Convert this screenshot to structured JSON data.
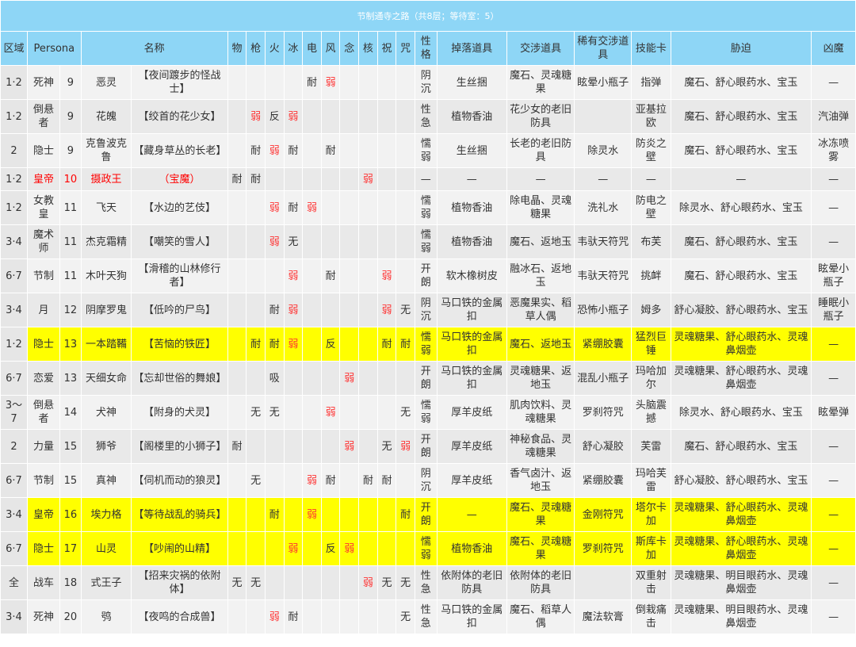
{
  "title": "节制通寺之路（共8层；等待室：5）",
  "headers": [
    "区域",
    "Persona",
    "",
    "名称",
    "物",
    "枪",
    "火",
    "冰",
    "电",
    "风",
    "念",
    "核",
    "祝",
    "咒",
    "性格",
    "掉落道具",
    "交涉道具",
    "稀有交涉道具",
    "技能卡",
    "胁迫",
    "凶魔"
  ],
  "colors": {
    "header_bg": "#8ed6f6",
    "highlight": "#ffff00",
    "weak": "#ff3333"
  },
  "rows": [
    {
      "zone": "1·2",
      "arcana": "死神",
      "lv": "9",
      "persona": "恶灵",
      "name": "【夜间踱步的怪战士】",
      "res": [
        "",
        "",
        "",
        "",
        "耐",
        "弱",
        "",
        "",
        "",
        ""
      ],
      "nature": "阴沉",
      "drop": "生丝捆",
      "nego": "魔石、灵魂糖果",
      "rare": "眩晕小瓶子",
      "card": "指弹",
      "threat": "魔石、舒心眼药水、宝玉",
      "demon": "—"
    },
    {
      "zone": "1·2",
      "arcana": "倒悬者",
      "lv": "9",
      "persona": "花魄",
      "name": "【绞首的花少女】",
      "res": [
        "",
        "弱",
        "反",
        "弱",
        "",
        "",
        "",
        "",
        "",
        ""
      ],
      "nature": "性急",
      "drop": "植物香油",
      "nego": "花少女的老旧防具",
      "rare": "",
      "card": "亚基拉欧",
      "threat": "魔石、舒心眼药水、宝玉",
      "demon": "汽油弹"
    },
    {
      "zone": "2",
      "arcana": "隐士",
      "lv": "9",
      "persona": "克鲁波克鲁",
      "name": "【藏身草丛的长老】",
      "res": [
        "",
        "耐",
        "弱",
        "耐",
        "",
        "耐",
        "",
        "",
        "",
        ""
      ],
      "nature": "懦弱",
      "drop": "生丝捆",
      "nego": "长老的老旧防具",
      "rare": "除灵水",
      "card": "防炎之壁",
      "threat": "魔石、舒心眼药水、宝玉",
      "demon": "冰冻喷雾"
    },
    {
      "zone": "1·2",
      "arcana": "皇帝",
      "lv": "10",
      "persona": "摄政王",
      "name": "（宝魔）",
      "res": [
        "耐",
        "耐",
        "",
        "",
        "",
        "",
        "",
        "弱",
        "",
        ""
      ],
      "nature": "—",
      "drop": "—",
      "nego": "—",
      "rare": "—",
      "card": "—",
      "threat": "—",
      "demon": "—"
    },
    {
      "zone": "1·2",
      "arcana": "女教皇",
      "lv": "11",
      "persona": "飞天",
      "name": "【水边的艺伎】",
      "res": [
        "",
        "",
        "弱",
        "耐",
        "弱",
        "",
        "",
        "",
        "",
        ""
      ],
      "nature": "懦弱",
      "drop": "植物香油",
      "nego": "除电晶、灵魂糖果",
      "rare": "洗礼水",
      "card": "防电之壁",
      "threat": "除灵水、舒心眼药水、宝玉",
      "demon": "—"
    },
    {
      "zone": "3·4",
      "arcana": "魔术师",
      "lv": "11",
      "persona": "杰克霜精",
      "name": "【嘲笑的雪人】",
      "res": [
        "",
        "",
        "弱",
        "无",
        "",
        "",
        "",
        "",
        "",
        ""
      ],
      "nature": "懦弱",
      "drop": "植物香油",
      "nego": "魔石、返地玉",
      "rare": "韦驮天符咒",
      "card": "布芙",
      "threat": "魔石、舒心眼药水、宝玉",
      "demon": "—"
    },
    {
      "zone": "6·7",
      "arcana": "节制",
      "lv": "11",
      "persona": "木叶天狗",
      "name": "【滑稽的山林修行者】",
      "res": [
        "",
        "",
        "",
        "弱",
        "",
        "耐",
        "",
        "",
        "弱",
        ""
      ],
      "nature": "开朗",
      "drop": "软木橡树皮",
      "nego": "融冰石、返地玉",
      "rare": "韦驮天符咒",
      "card": "挑衅",
      "threat": "魔石、舒心眼药水、宝玉",
      "demon": "眩晕小瓶子"
    },
    {
      "zone": "3·4",
      "arcana": "月",
      "lv": "12",
      "persona": "阴摩罗鬼",
      "name": "【低吟的尸鸟】",
      "res": [
        "",
        "",
        "耐",
        "弱",
        "",
        "",
        "",
        "",
        "弱",
        "无"
      ],
      "nature": "阴沉",
      "drop": "马口铁的金属扣",
      "nego": "恶魔果实、稻草人偶",
      "rare": "恐怖小瓶子",
      "card": "姆多",
      "threat": "舒心凝胶、舒心眼药水、宝玉",
      "demon": "睡眠小瓶子"
    },
    {
      "zone": "1·2",
      "arcana": "隐士",
      "lv": "13",
      "persona": "一本踏鞴",
      "name": "【苦恼的铁匠】",
      "res": [
        "",
        "耐",
        "耐",
        "弱",
        "",
        "反",
        "",
        "",
        "耐",
        "耐"
      ],
      "nature": "懦弱",
      "drop": "马口铁的金属扣",
      "nego": "魔石、返地玉",
      "rare": "紧绷胶囊",
      "card": "猛烈巨锤",
      "threat": "灵魂糖果、舒心眼药水、灵魂鼻烟壶",
      "demon": "—",
      "hl": true
    },
    {
      "zone": "6·7",
      "arcana": "恋爱",
      "lv": "13",
      "persona": "天细女命",
      "name": "【忘却世俗的舞娘】",
      "res": [
        "",
        "",
        "吸",
        "",
        "",
        "",
        "弱",
        "",
        "",
        ""
      ],
      "nature": "开朗",
      "drop": "马口铁的金属扣",
      "nego": "灵魂糖果、返地玉",
      "rare": "混乱小瓶子",
      "card": "玛哈加尔",
      "threat": "灵魂糖果、舒心眼药水、灵魂鼻烟壶",
      "demon": "—"
    },
    {
      "zone": "3～7",
      "arcana": "倒悬者",
      "lv": "14",
      "persona": "犬神",
      "name": "【附身的犬灵】",
      "res": [
        "",
        "无",
        "无",
        "",
        "",
        "弱",
        "",
        "",
        "",
        "无"
      ],
      "nature": "懦弱",
      "drop": "厚羊皮纸",
      "nego": "肌肉饮料、灵魂糖果",
      "rare": "罗刹符咒",
      "card": "头脑震撼",
      "threat": "除灵水、舒心眼药水、宝玉",
      "demon": "眩晕弹"
    },
    {
      "zone": "2",
      "arcana": "力量",
      "lv": "15",
      "persona": "狮爷",
      "name": "【阁楼里的小狮子】",
      "res": [
        "耐",
        "",
        "",
        "",
        "",
        "",
        "弱",
        "",
        "无",
        "弱"
      ],
      "nature": "开朗",
      "drop": "厚羊皮纸",
      "nego": "神秘食品、灵魂糖果",
      "rare": "舒心凝胶",
      "card": "芙雷",
      "threat": "魔石、舒心眼药水、宝玉",
      "demon": "—"
    },
    {
      "zone": "6·7",
      "arcana": "节制",
      "lv": "15",
      "persona": "真神",
      "name": "【伺机而动的狼灵】",
      "res": [
        "",
        "无",
        "",
        "",
        "弱",
        "耐",
        "",
        "耐",
        "耐",
        ""
      ],
      "nature": "阴沉",
      "drop": "厚羊皮纸",
      "nego": "香气卤汁、返地玉",
      "rare": "紧绷胶囊",
      "card": "玛哈芙雷",
      "threat": "舒心凝胶、舒心眼药水、宝玉",
      "demon": "—"
    },
    {
      "zone": "3·4",
      "arcana": "皇帝",
      "lv": "16",
      "persona": "埃力格",
      "name": "【等待战乱的骑兵】",
      "res": [
        "",
        "",
        "耐",
        "",
        "弱",
        "",
        "",
        "",
        "",
        "耐"
      ],
      "nature": "开朗",
      "drop": "—",
      "nego": "魔石、灵魂糖果",
      "rare": "金刚符咒",
      "card": "塔尔卡加",
      "threat": "灵魂糖果、舒心眼药水、灵魂鼻烟壶",
      "demon": "—",
      "hl": true
    },
    {
      "zone": "6·7",
      "arcana": "隐士",
      "lv": "17",
      "persona": "山灵",
      "name": "【吵闹的山精】",
      "res": [
        "",
        "",
        "",
        "弱",
        "",
        "反",
        "弱",
        "",
        "",
        ""
      ],
      "nature": "懦弱",
      "drop": "植物香油",
      "nego": "魔石、灵魂糖果",
      "rare": "罗刹符咒",
      "card": "斯库卡加",
      "threat": "灵魂糖果、舒心眼药水、灵魂鼻烟壶",
      "demon": "—",
      "hl": true
    },
    {
      "zone": "全",
      "arcana": "战车",
      "lv": "18",
      "persona": "式王子",
      "name": "【招来灾祸的依附体】",
      "res": [
        "无",
        "无",
        "",
        "",
        "",
        "",
        "",
        "弱",
        "无",
        "无"
      ],
      "nature": "性急",
      "drop": "依附体的老旧防具",
      "nego": "依附体的老旧防具",
      "rare": "",
      "card": "双重射击",
      "threat": "灵魂糖果、明目眼药水、灵魂鼻烟壶",
      "demon": "—"
    },
    {
      "zone": "3·4",
      "arcana": "死神",
      "lv": "20",
      "persona": "鸮",
      "name": "【夜鸣的合成兽】",
      "res": [
        "",
        "",
        "弱",
        "耐",
        "",
        "",
        "",
        "",
        "",
        "无"
      ],
      "nature": "性急",
      "drop": "马口铁的金属扣",
      "nego": "魔石、稻草人偶",
      "rare": "魔法软膏",
      "card": "倒栽痛击",
      "threat": "灵魂糖果、明目眼药水、灵魂鼻烟壶",
      "demon": "—"
    }
  ]
}
